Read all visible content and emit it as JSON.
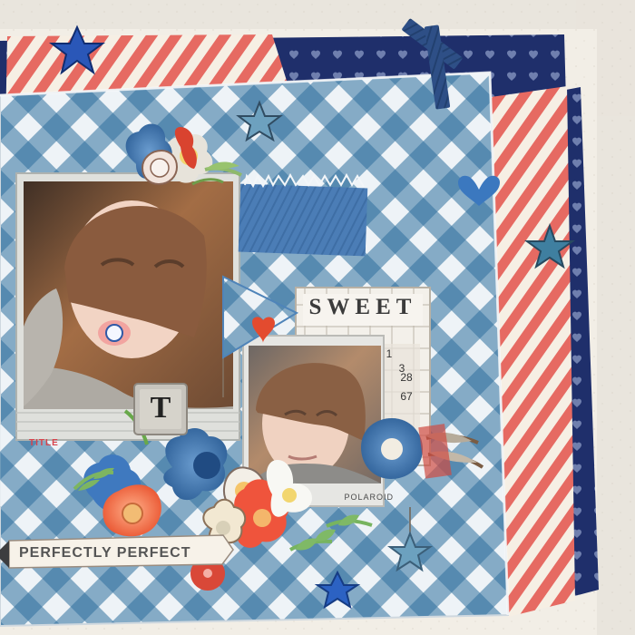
{
  "palette": {
    "gingham_blue": "#2f6f9f",
    "gingham_light": "#eef3f7",
    "stripe_red": "#e66a62",
    "stripe_cream": "#f6efe4",
    "denim_navy": "#1f2f6b",
    "paper_cream": "#f2eee6"
  },
  "embellishments": {
    "sweet_card": {
      "title": "SWEET",
      "numbers": [
        "1",
        "3",
        "28",
        "67"
      ]
    },
    "letter_tile": {
      "letter": "T"
    },
    "photo_label_left": {
      "title_text": "TITLE"
    },
    "photo_label_right": {
      "text": "POLAROID"
    },
    "banner": {
      "text": "PERFECTLY PERFECT"
    }
  }
}
